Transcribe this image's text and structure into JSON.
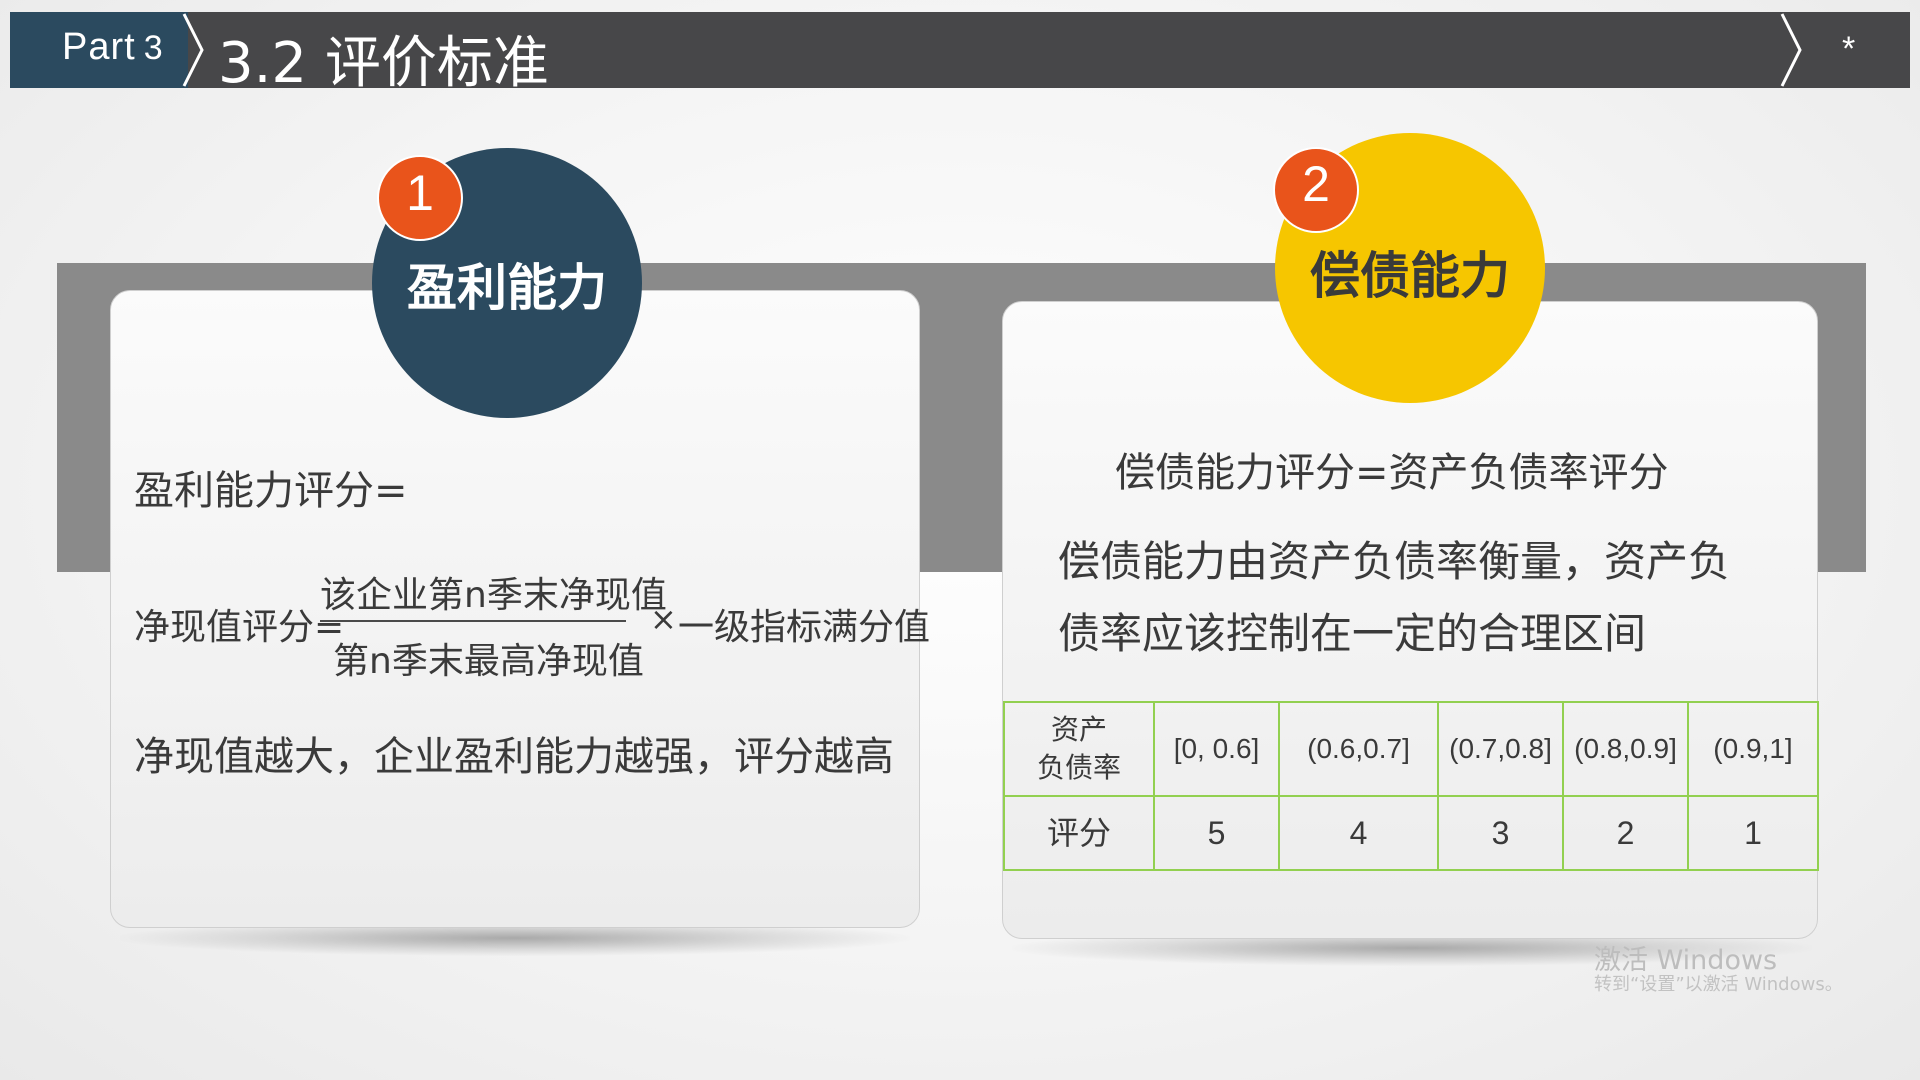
{
  "header": {
    "part_label": "Part",
    "part_number": "3",
    "title": "3.2 评价标准",
    "star": "*"
  },
  "colors": {
    "header_dark": "#474749",
    "header_part": "#2b4a5f",
    "circle_1": "#2b4a5f",
    "circle_2": "#f6c600",
    "badge": "#e9541b",
    "band": "#8a8a8a",
    "table_border": "#92d050"
  },
  "profit": {
    "badge_number": "1",
    "title": "盈利能力",
    "formula": "盈利能力评分=",
    "npv_label": "净现值评分=",
    "numerator": "该企业第n季末净现值",
    "denominator": "第n季末最高净现值",
    "times": "×",
    "suffix": "一级指标满分值",
    "description": "净现值越大，企业盈利能力越强，评分越高"
  },
  "solvency": {
    "badge_number": "2",
    "title": "偿债能力",
    "formula": "偿债能力评分=资产负债率评分",
    "description_line1": "偿债能力由资产负债率衡量，资产负",
    "description_line2": "债率应该控制在一定的合理区间"
  },
  "table": {
    "header_label_line1": "资产",
    "header_label_line2": "负债率",
    "ranges": [
      "[0, 0.6]",
      "(0.6,0.7]",
      "(0.7,0.8]",
      "(0.8,0.9]",
      "(0.9,1]"
    ],
    "score_label": "评分",
    "scores": [
      "5",
      "4",
      "3",
      "2",
      "1"
    ]
  },
  "watermark": {
    "line1": "激活 Windows",
    "line2": "转到“设置”以激活 Windows。"
  }
}
